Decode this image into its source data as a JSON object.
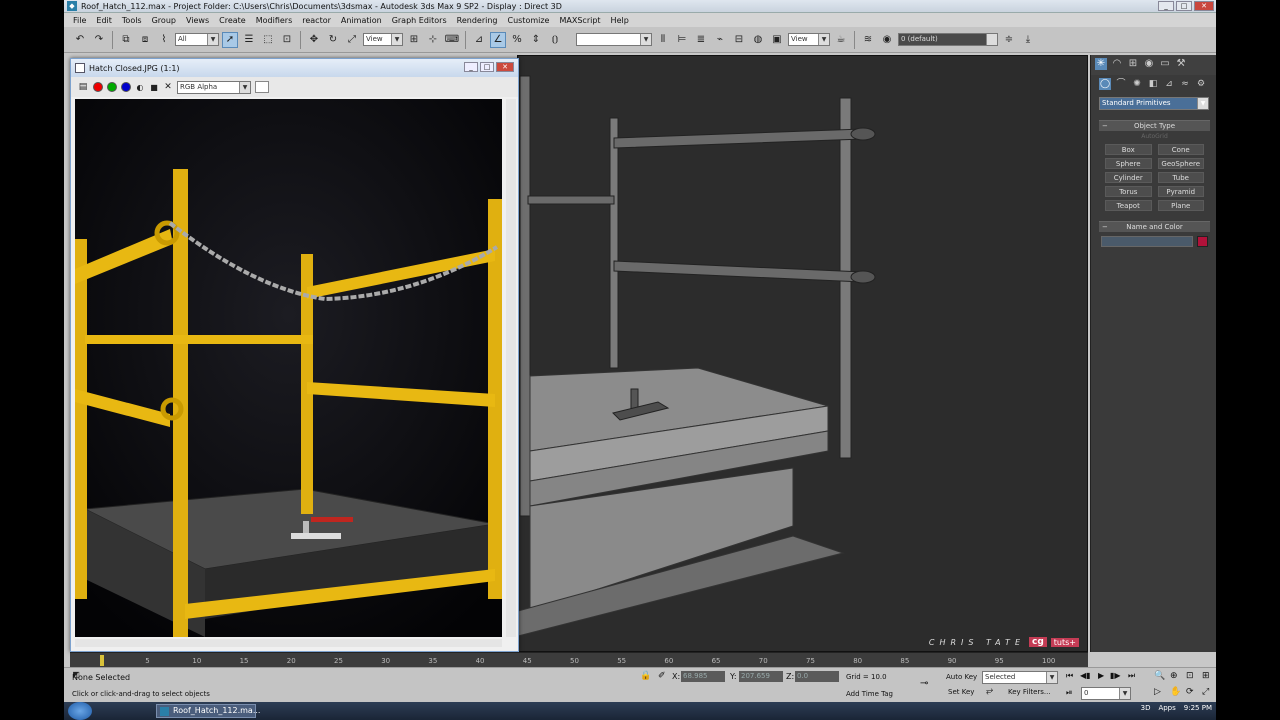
{
  "titlebar": {
    "text": "Roof_Hatch_112.max      - Project Folder: C:\\Users\\Chris\\Documents\\3dsmax      - Autodesk 3ds Max 9 SP2      - Display : Direct 3D",
    "controls": [
      "_",
      "□",
      "✕"
    ]
  },
  "menu": [
    "File",
    "Edit",
    "Tools",
    "Group",
    "Views",
    "Create",
    "Modifiers",
    "reactor",
    "Animation",
    "Graph Editors",
    "Rendering",
    "Customize",
    "MAXScript",
    "Help"
  ],
  "toolbar": {
    "selection_filter": "All",
    "ref_coord": "View",
    "view2": "View",
    "layer": "0 (default)"
  },
  "image_window": {
    "title": "Hatch Closed.JPG (1:1)",
    "channel": "RGB Alpha"
  },
  "command_panel": {
    "category": "Standard Primitives",
    "rollout_object_type": "Object Type",
    "autogrid": "AutoGrid",
    "primitives": [
      "Box",
      "Cone",
      "Sphere",
      "GeoSphere",
      "Cylinder",
      "Tube",
      "Torus",
      "Pyramid",
      "Teapot",
      "Plane"
    ],
    "rollout_name_color": "Name and Color",
    "color": "#b0123a"
  },
  "timeline": {
    "ticks": [
      "0",
      "5",
      "10",
      "15",
      "20",
      "25",
      "30",
      "35",
      "40",
      "45",
      "50",
      "55",
      "60",
      "65",
      "70",
      "75",
      "80",
      "85",
      "90",
      "95",
      "100"
    ],
    "frame_position": 0
  },
  "status": {
    "selection": "None Selected",
    "prompt": "Click or click-and-drag to select objects",
    "x_value": "68.985",
    "y_value": "207.659",
    "z_value": "0.0",
    "grid": "Grid = 10.0",
    "add_time_tag": "Add Time Tag",
    "auto_key": "Auto Key",
    "set_key": "Set Key",
    "key_mode": "Selected",
    "key_filters": "Key Filters...",
    "frame_field": "0",
    "x_label": "X:",
    "y_label": "Y:",
    "z_label": "Z:"
  },
  "watermark": {
    "author": "CHRIS TATE",
    "brand1": "cg",
    "brand2": "tuts+"
  },
  "taskbar": {
    "task": "Roof_Hatch_112.ma...",
    "tray_3d": "3D",
    "tray_apps": "Apps",
    "time": "9:25 PM"
  }
}
